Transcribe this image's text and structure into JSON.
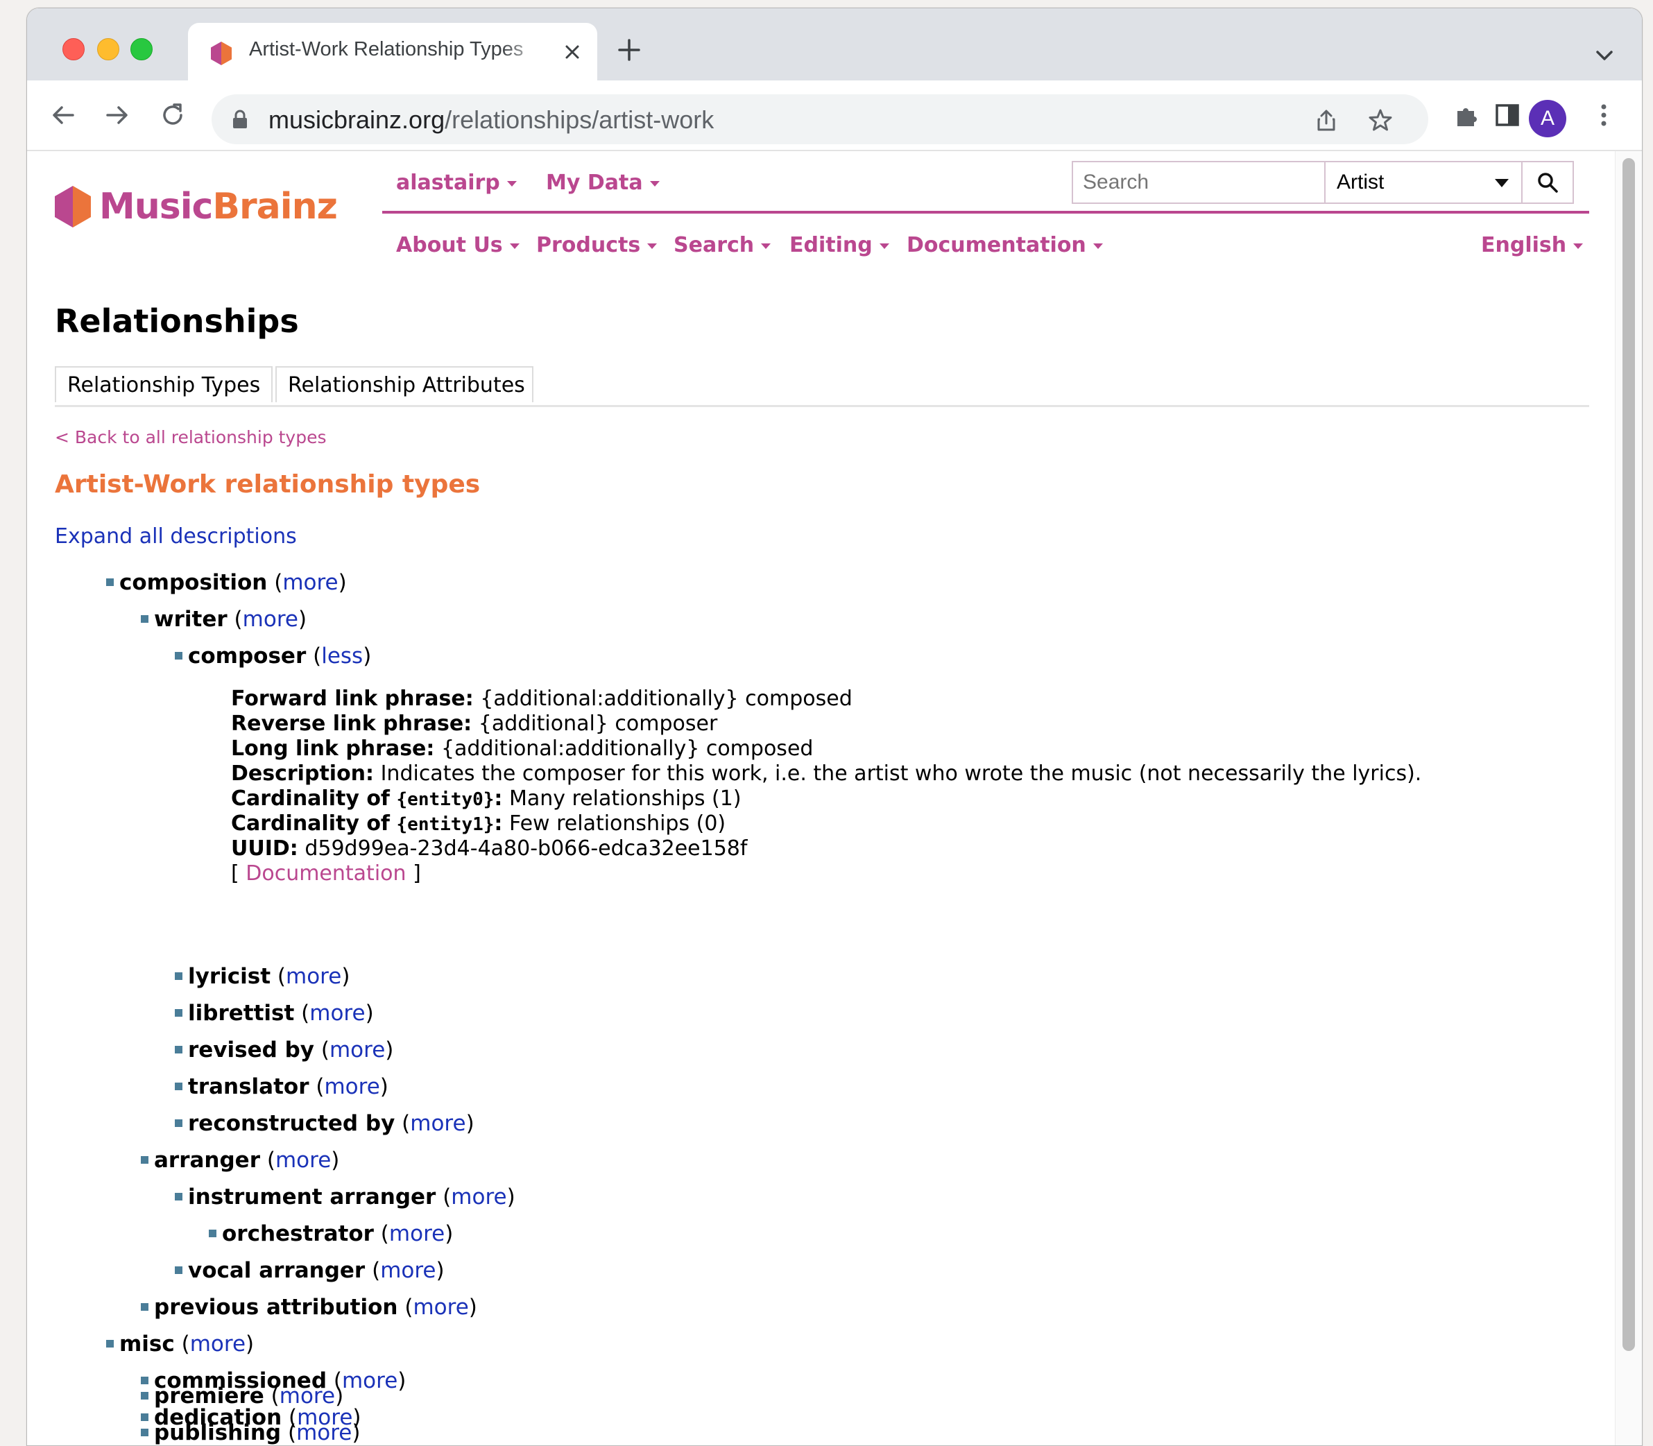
{
  "browser": {
    "tab_title": "Artist-Work Relationship Types",
    "url_domain": "musicbrainz.org",
    "url_path": "/relationships/artist-work",
    "avatar_letter": "A"
  },
  "header": {
    "logo_music": "Music",
    "logo_brainz": "Brainz",
    "user_menu": "alastairp",
    "my_data_menu": "My Data",
    "search_placeholder": "Search",
    "search_type": "Artist",
    "nav": [
      "About Us",
      "Products",
      "Search",
      "Editing",
      "Documentation"
    ],
    "language": "English"
  },
  "page": {
    "title": "Relationships",
    "tabs": [
      "Relationship Types",
      "Relationship Attributes"
    ],
    "back_link": "< Back to all relationship types",
    "section_title": "Artist-Work relationship types",
    "expand_all": "Expand all descriptions"
  },
  "tree": [
    {
      "name": "composition",
      "toggle": "more"
    },
    {
      "name": "writer",
      "toggle": "more"
    },
    {
      "name": "composer",
      "toggle": "less"
    },
    {
      "name": "lyricist",
      "toggle": "more"
    },
    {
      "name": "librettist",
      "toggle": "more"
    },
    {
      "name": "revised by",
      "toggle": "more"
    },
    {
      "name": "translator",
      "toggle": "more"
    },
    {
      "name": "reconstructed by",
      "toggle": "more"
    },
    {
      "name": "arranger",
      "toggle": "more"
    },
    {
      "name": "instrument arranger",
      "toggle": "more"
    },
    {
      "name": "orchestrator",
      "toggle": "more"
    },
    {
      "name": "vocal arranger",
      "toggle": "more"
    },
    {
      "name": "previous attribution",
      "toggle": "more"
    },
    {
      "name": "misc",
      "toggle": "more"
    },
    {
      "name": "commissioned",
      "toggle": "more"
    },
    {
      "name": "dedication",
      "toggle": "more"
    },
    {
      "name": "premiere",
      "toggle": "more"
    },
    {
      "name": "publishing",
      "toggle": "more"
    }
  ],
  "composer_details": {
    "forward_label": "Forward link phrase:",
    "forward_value": "{additional:additionally} composed",
    "reverse_label": "Reverse link phrase:",
    "reverse_value": "{additional} composer",
    "long_label": "Long link phrase:",
    "long_value": "{additional:additionally} composed",
    "description_label": "Description:",
    "description_value": "Indicates the composer for this work, i.e. the artist who wrote the music (not necessarily the lyrics).",
    "cardinality_label": "Cardinality of",
    "entity0": "{entity0}",
    "entity0_value": "Many relationships (1)",
    "entity1": "{entity1}",
    "entity1_value": "Few relationships (0)",
    "uuid_label": "UUID:",
    "uuid_value": "d59d99ea-23d4-4a80-b066-edca32ee158f",
    "doc_link": "Documentation"
  },
  "colors": {
    "brand_pink": "#ba478f",
    "brand_orange": "#eb743b",
    "link_blue": "#1a32b8",
    "bullet": "#4a7d98"
  }
}
